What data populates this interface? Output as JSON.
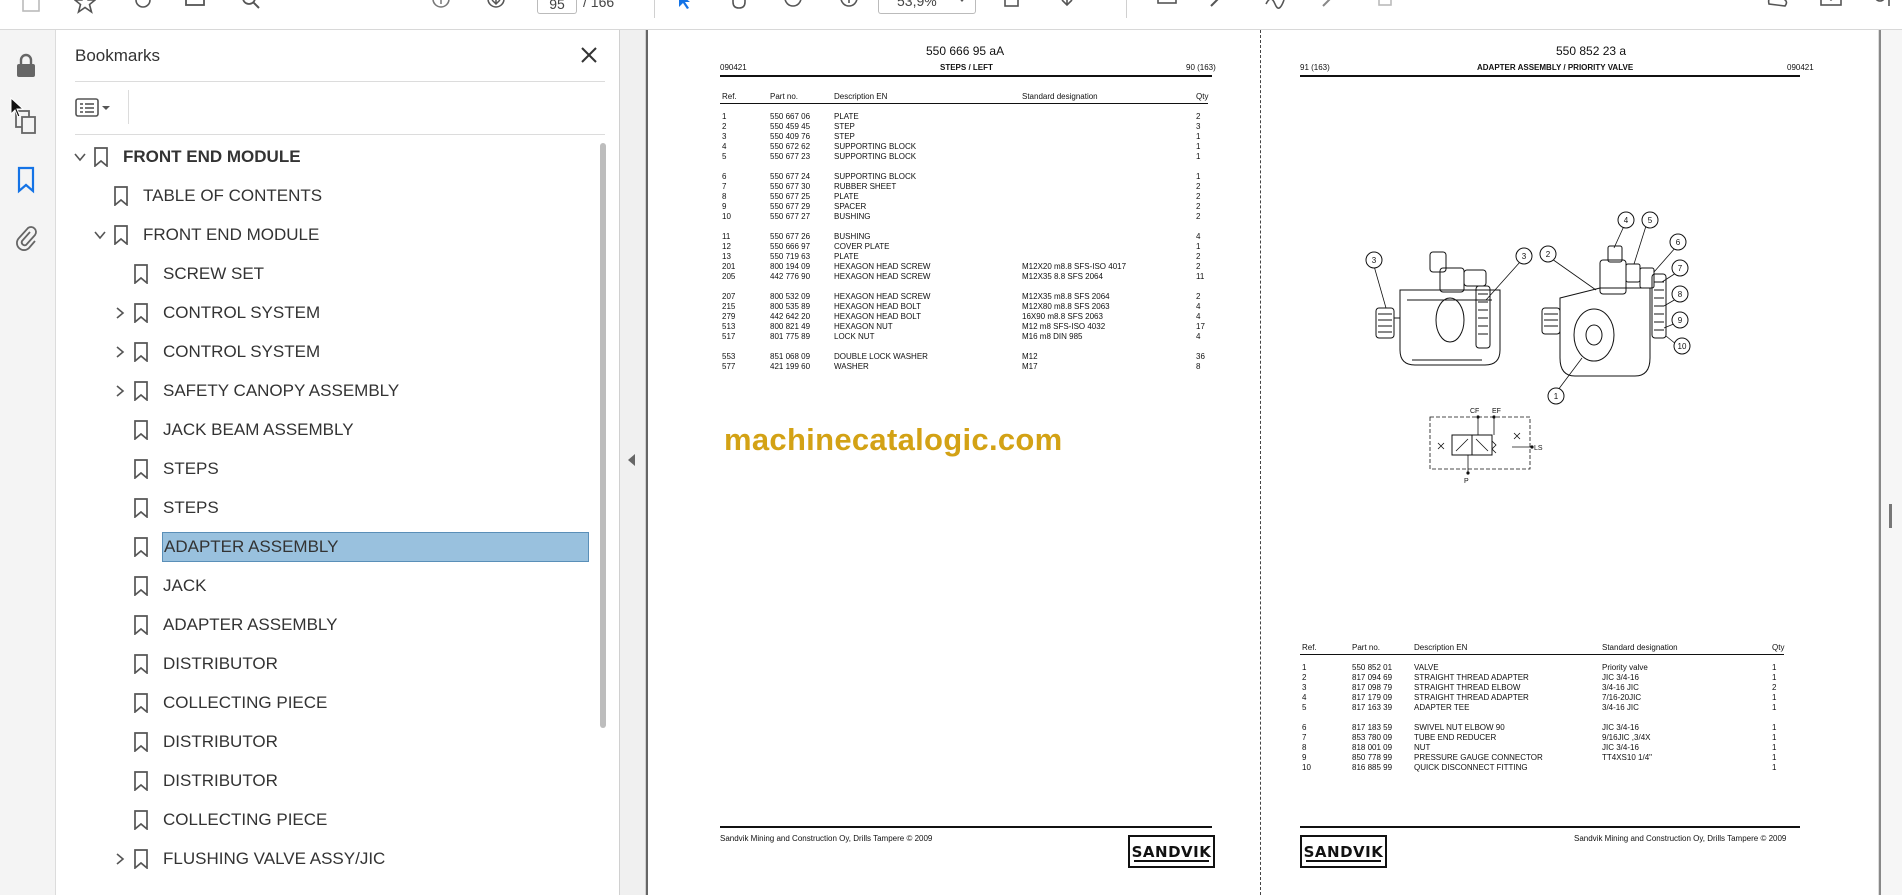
{
  "toolbar": {
    "page_current": "95",
    "page_total": "/ 166",
    "zoom": "53,9%"
  },
  "bookmarks": {
    "title": "Bookmarks",
    "items": [
      {
        "label": "FRONT END MODULE",
        "level": 0,
        "expander": "open",
        "bold": true
      },
      {
        "label": "TABLE OF CONTENTS",
        "level": 1,
        "expander": "none"
      },
      {
        "label": "FRONT END MODULE",
        "level": 1,
        "expander": "open"
      },
      {
        "label": "SCREW SET",
        "level": 2,
        "expander": "none"
      },
      {
        "label": "CONTROL SYSTEM",
        "level": 2,
        "expander": "closed"
      },
      {
        "label": "CONTROL SYSTEM",
        "level": 2,
        "expander": "closed"
      },
      {
        "label": "SAFETY CANOPY ASSEMBLY",
        "level": 2,
        "expander": "closed"
      },
      {
        "label": "JACK BEAM ASSEMBLY",
        "level": 2,
        "expander": "none"
      },
      {
        "label": "STEPS",
        "level": 2,
        "expander": "none"
      },
      {
        "label": "STEPS",
        "level": 2,
        "expander": "none"
      },
      {
        "label": "ADAPTER ASSEMBLY",
        "level": 2,
        "expander": "none",
        "selected": true
      },
      {
        "label": "JACK",
        "level": 2,
        "expander": "none"
      },
      {
        "label": "ADAPTER ASSEMBLY",
        "level": 2,
        "expander": "none"
      },
      {
        "label": "DISTRIBUTOR",
        "level": 2,
        "expander": "none"
      },
      {
        "label": "COLLECTING PIECE",
        "level": 2,
        "expander": "none"
      },
      {
        "label": "DISTRIBUTOR",
        "level": 2,
        "expander": "none"
      },
      {
        "label": "DISTRIBUTOR",
        "level": 2,
        "expander": "none"
      },
      {
        "label": "COLLECTING PIECE",
        "level": 2,
        "expander": "none"
      },
      {
        "label": "FLUSHING VALVE ASSY/JIC",
        "level": 2,
        "expander": "closed"
      }
    ]
  },
  "left_page": {
    "part_code": "550 666 95 aA",
    "date": "090421",
    "title": "STEPS / LEFT",
    "page_ref": "90 (163)",
    "columns": [
      "Ref.",
      "Part no.",
      "Description EN",
      "Standard designation",
      "Qty"
    ],
    "rows": [
      [
        "1",
        "550 667 06",
        "PLATE",
        "",
        "2"
      ],
      [
        "2",
        "550 459 45",
        "STEP",
        "",
        "3"
      ],
      [
        "3",
        "550 409 76",
        "STEP",
        "",
        "1"
      ],
      [
        "4",
        "550 672 62",
        "SUPPORTING BLOCK",
        "",
        "1"
      ],
      [
        "5",
        "550 677 23",
        "SUPPORTING BLOCK",
        "",
        "1"
      ],
      [
        "6",
        "550 677 24",
        "SUPPORTING BLOCK",
        "",
        "1"
      ],
      [
        "7",
        "550 677 30",
        "RUBBER SHEET",
        "",
        "2"
      ],
      [
        "8",
        "550 677 25",
        "PLATE",
        "",
        "2"
      ],
      [
        "9",
        "550 677 29",
        "SPACER",
        "",
        "2"
      ],
      [
        "10",
        "550 677 27",
        "BUSHING",
        "",
        "2"
      ],
      [
        "11",
        "550 677 26",
        "BUSHING",
        "",
        "4"
      ],
      [
        "12",
        "550 666 97",
        "COVER PLATE",
        "",
        "1"
      ],
      [
        "13",
        "550 719 63",
        "PLATE",
        "",
        "2"
      ],
      [
        "201",
        "800 194 09",
        "HEXAGON HEAD SCREW",
        "M12X20 m8.8 SFS-ISO 4017",
        "2"
      ],
      [
        "205",
        "442 776 90",
        "HEXAGON HEAD SCREW",
        "M12X35 8.8 SFS 2064",
        "11"
      ],
      [
        "207",
        "800 532 09",
        "HEXAGON HEAD SCREW",
        "M12X35 m8.8 SFS 2064",
        "2"
      ],
      [
        "215",
        "800 535 89",
        "HEXAGON HEAD BOLT",
        "M12X80 m8.8 SFS 2063",
        "4"
      ],
      [
        "279",
        "442 642 20",
        "HEXAGON HEAD BOLT",
        "16X90 m8.8 SFS 2063",
        "4"
      ],
      [
        "513",
        "800 821 49",
        "HEXAGON NUT",
        "M12 m8 SFS-ISO 4032",
        "17"
      ],
      [
        "517",
        "801 775 89",
        "LOCK NUT",
        "M16 m8 DIN 985",
        "4"
      ],
      [
        "553",
        "851 068 09",
        "DOUBLE LOCK WASHER",
        "M12",
        "36"
      ],
      [
        "577",
        "421 199 60",
        "WASHER",
        "M17",
        "8"
      ]
    ],
    "watermark": "machinecatalogic.com",
    "footer": "Sandvik Mining and Construction Oy, Drills Tampere © 2009",
    "logo": "SANDVIK"
  },
  "right_page": {
    "part_code": "550 852 23 a",
    "page_ref": "91 (163)",
    "title": "ADAPTER ASSEMBLY / PRIORITY VALVE",
    "date": "090421",
    "callouts": [
      "1",
      "2",
      "3",
      "3",
      "4",
      "5",
      "6",
      "7",
      "8",
      "9",
      "10"
    ],
    "schematic_labels": [
      "CF",
      "EF",
      "LS",
      "P"
    ],
    "columns": [
      "Ref.",
      "Part no.",
      "Description EN",
      "Standard designation",
      "Qty"
    ],
    "rows": [
      [
        "1",
        "550 852 01",
        "VALVE",
        "Priority valve",
        "1"
      ],
      [
        "2",
        "817 094 69",
        "STRAIGHT THREAD ADAPTER",
        "JIC 3/4-16",
        "1"
      ],
      [
        "3",
        "817 098 79",
        "STRAIGHT THREAD ELBOW",
        "3/4-16 JIC",
        "2"
      ],
      [
        "4",
        "817 179 09",
        "STRAIGHT THREAD ADAPTER",
        "7/16-20JIC",
        "1"
      ],
      [
        "5",
        "817 163 39",
        "ADAPTER TEE",
        "3/4-16 JIC",
        "1"
      ],
      [
        "6",
        "817 183 59",
        "SWIVEL NUT ELBOW 90",
        "JIC 3/4-16",
        "1"
      ],
      [
        "7",
        "853 780 09",
        "TUBE END REDUCER",
        "9/16JIC ,3/4X",
        "1"
      ],
      [
        "8",
        "818 001 09",
        "NUT",
        "JIC 3/4-16",
        "1"
      ],
      [
        "9",
        "850 778 99",
        "PRESSURE GAUGE CONNECTOR",
        "TT4XS10 1/4\"",
        "1"
      ],
      [
        "10",
        "816 885 99",
        "QUICK DISCONNECT FITTING",
        "",
        "1"
      ]
    ],
    "footer": "Sandvik Mining and Construction Oy, Drills Tampere © 2009",
    "logo": "SANDVIK"
  }
}
